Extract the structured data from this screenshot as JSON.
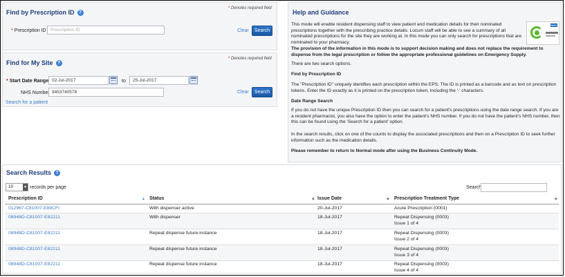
{
  "find_by_id": {
    "title": "Find by Prescription ID",
    "required_note": "Denotes required field",
    "field_label": "Prescription ID",
    "field_placeholder": "Prescription ID",
    "clear_label": "Clear",
    "search_label": "Search"
  },
  "find_my_site": {
    "title": "Find for My Site",
    "required_note": "Denotes required field",
    "date_label": "Start Date Range",
    "date_from": "02-Jul-2017",
    "date_to_label": "to",
    "date_to": "25-Jul-2017",
    "nhs_label": "NHS Number",
    "nhs_value": "9453740578",
    "search_patient_link": "Search for a patient",
    "clear_label": "Clear",
    "search_label": "Search"
  },
  "help": {
    "title": "Help and Guidance",
    "logo_badge": "NHS",
    "p1": "This mode will enable resident dispensing staff to view patient and medication details for their nominated prescriptions together with the prescribing practice details. Locum staff will be able to see a summary of all nominated prescriptions for the site they are working at. In this mode you can only search for prescriptions that are nominated to your pharmacy.",
    "p2": "The provision of the information in this mode is to support decision making and does not replace the requirement to dispense from the legal prescription or follow the appropriate professional guidelines on Emergency Supply.",
    "p3": "There are two search options.",
    "h1": "Find by Prescription ID",
    "p4": "The \"Prescription ID\" uniquely identifies each prescription within the EPS. The ID is printed as a barcode and as text on prescription tokens. Enter the ID exactly as it is printed on the prescription token, including the '-' characters.",
    "h2": "Date Range Search",
    "p5": "If you do not have the unique Prescription ID then you can search for a patient's prescriptions using the date range search. If you are a resident pharmacist, you also have the option to enter the patient's NHS number. If you do not have the patient's NHS number, then this can be found using the 'Search for a patient' option.",
    "p6": "In the search results, click on one of the counts to display the associated prescriptions and then on a Prescription ID to seek further information such as the medication details.",
    "p7": "Please remember to return to Normal mode after using the Business Continuity Mode."
  },
  "results": {
    "title": "Search Results",
    "page_size": "10",
    "records_label": "records per page",
    "search_label": "Search:",
    "columns": [
      "Prescription ID",
      "Status",
      "Issue Date",
      "Prescription Treatment Type"
    ],
    "rows": [
      {
        "id": "012967-C81007-E88CFI",
        "status": "With dispenser active",
        "date": "20-Jul-2017",
        "type": "Acute Prescription (0001)",
        "issue": ""
      },
      {
        "id": "08948D-C81007-E82211",
        "status": "With dispenser",
        "date": "18-Jul-2017",
        "type": "Repeat Dispensing (0003)",
        "issue": "Issue 1 of 4"
      },
      {
        "id": "08948D-C81007-E82211",
        "status": "Repeat dispense future instance",
        "date": "18-Jul-2017",
        "type": "Repeat Dispensing (0003)",
        "issue": "Issue 2 of 4"
      },
      {
        "id": "08948D-C81007-E82211",
        "status": "Repeat dispense future instance",
        "date": "18-Jul-2017",
        "type": "Repeat Dispensing (0003)",
        "issue": "Issue 3 of 4"
      },
      {
        "id": "08948D-C81007-E82211",
        "status": "Repeat dispense future instance",
        "date": "18-Jul-2017",
        "type": "Repeat Dispensing (0003)",
        "issue": "Issue 4 of 4"
      }
    ]
  }
}
